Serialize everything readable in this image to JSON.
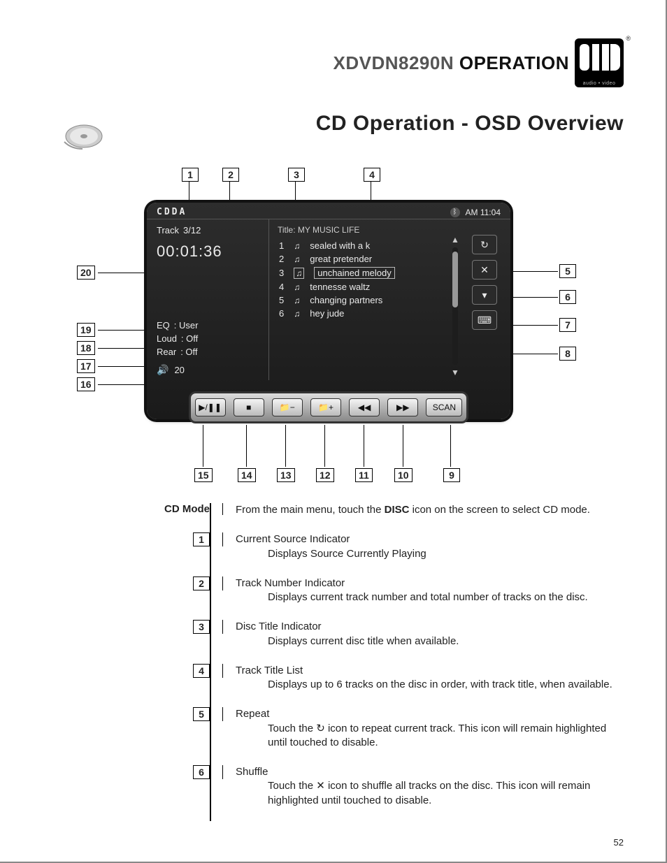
{
  "header": {
    "model": "XDVDN8290N",
    "section": "OPERATION",
    "brand_tag": "audio • video"
  },
  "title": "CD Operation - OSD Overview",
  "screen": {
    "source": "CDDA",
    "clock": "AM 11:04",
    "track_label": "Track",
    "track_value": "3/12",
    "elapsed": "00:01:36",
    "eq_label": "EQ",
    "eq_value": ": User",
    "loud_label": "Loud",
    "loud_value": ": Off",
    "rear_label": "Rear",
    "rear_value": ": Off",
    "volume": "20",
    "disc_title_label": "Title:",
    "disc_title": "MY  MUSIC LIFE",
    "tracks": [
      {
        "n": "1",
        "name": "sealed with a k"
      },
      {
        "n": "2",
        "name": "great pretender"
      },
      {
        "n": "3",
        "name": "unchained melody"
      },
      {
        "n": "4",
        "name": "tennesse waltz"
      },
      {
        "n": "5",
        "name": "changing partners"
      },
      {
        "n": "6",
        "name": "hey jude"
      }
    ],
    "side_buttons": {
      "repeat": "↻",
      "shuffle": "✕",
      "pagedn": "▾",
      "keypad": "⌨"
    },
    "bottom_buttons": {
      "play": "▶/❚❚",
      "stop": "■",
      "folder_minus": "📁−",
      "folder_plus": "📁+",
      "rew": "◀◀",
      "fwd": "▶▶",
      "scan": "SCAN"
    }
  },
  "callouts_top": [
    "1",
    "2",
    "3",
    "4"
  ],
  "callouts_right": [
    "5",
    "6",
    "7",
    "8"
  ],
  "callouts_left": [
    "20",
    "19",
    "18",
    "17",
    "16"
  ],
  "callouts_bottom": [
    "15",
    "14",
    "13",
    "12",
    "11",
    "10",
    "9"
  ],
  "desc": {
    "mode_label": "CD Mode",
    "mode_text_a": "From the main menu, touch the ",
    "mode_text_bold": "DISC",
    "mode_text_b": " icon on the screen to select CD mode.",
    "items": [
      {
        "n": "1",
        "title": "Current Source Indicator",
        "sub": "Displays Source Currently Playing"
      },
      {
        "n": "2",
        "title": "Track Number Indicator",
        "sub": "Displays current track number and total number of tracks on the disc."
      },
      {
        "n": "3",
        "title": "Disc Title Indicator",
        "sub": "Displays current disc title when available."
      },
      {
        "n": "4",
        "title": "Track Title List",
        "sub": "Displays up to 6 tracks on the disc in order, with track title, when available."
      },
      {
        "n": "5",
        "title": "Repeat",
        "sub": "Touch the ↻ icon to repeat current track. This icon will remain highlighted until touched to disable."
      },
      {
        "n": "6",
        "title": "Shuffle",
        "sub": "Touch the ✕ icon to shuffle all tracks on the disc. This icon will remain highlighted until touched to disable."
      }
    ]
  },
  "page_number": "52"
}
